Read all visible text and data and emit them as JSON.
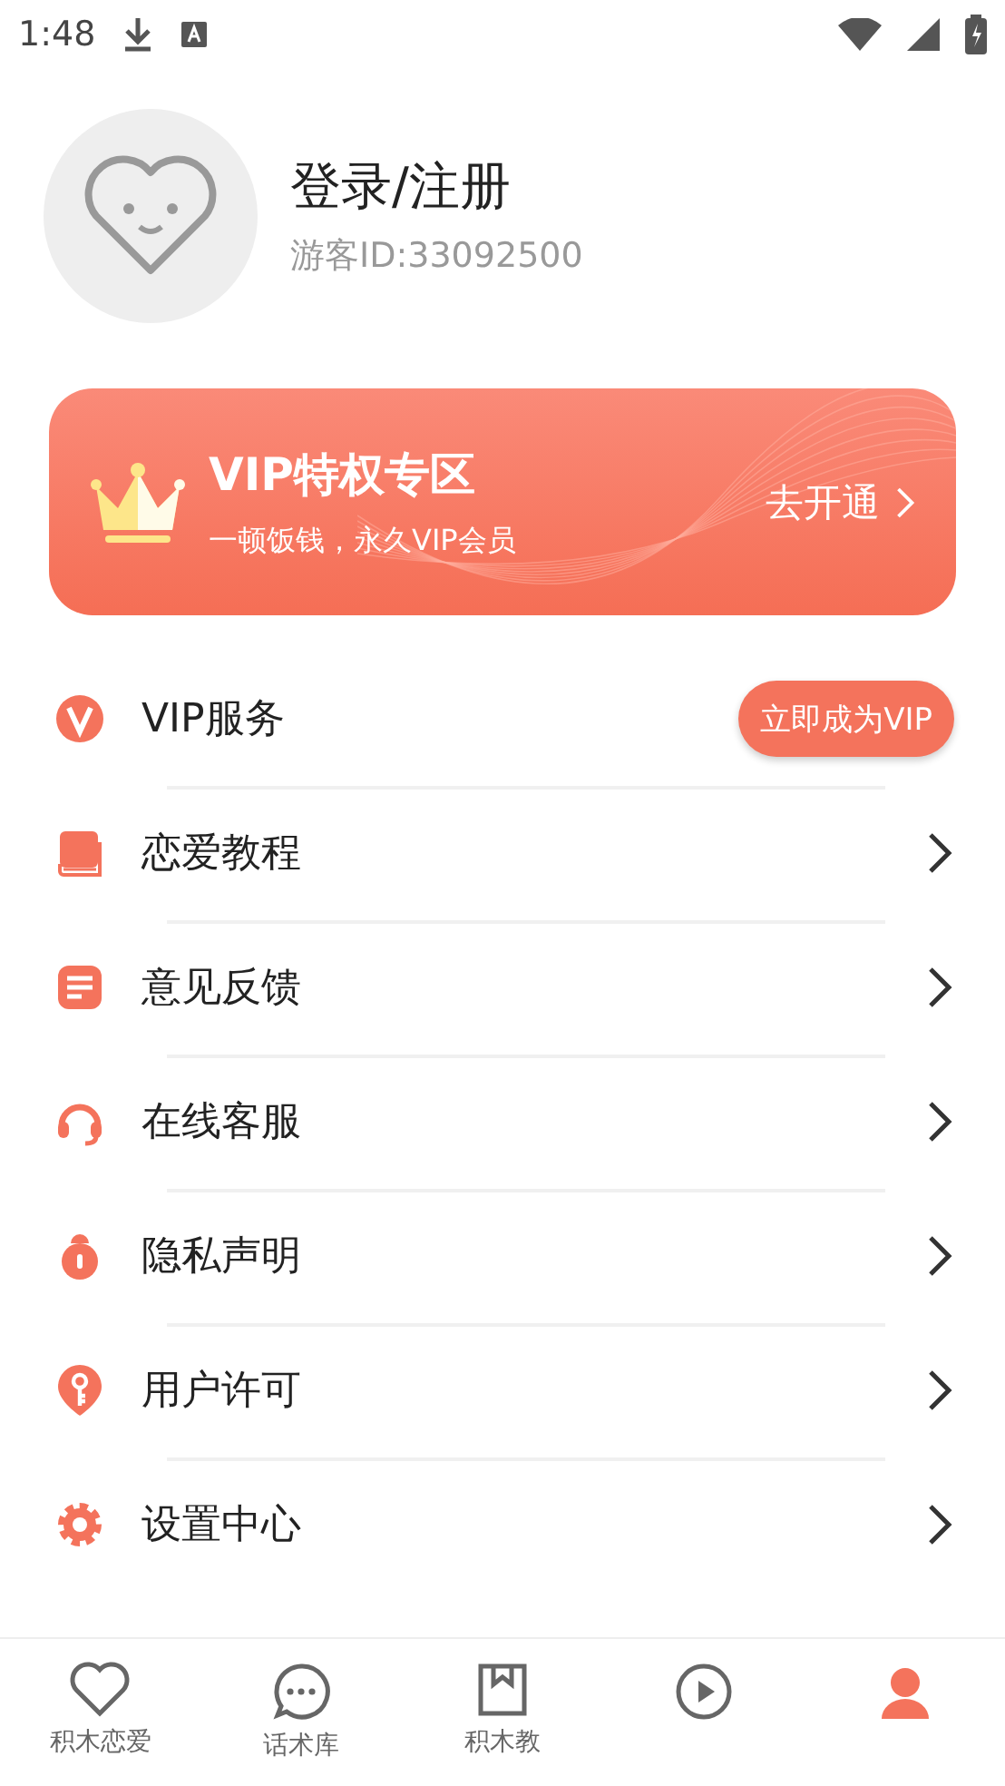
{
  "status_bar": {
    "time": "1:48"
  },
  "profile": {
    "title": "登录/注册",
    "guest_id": "游客ID:33092500"
  },
  "vip_banner": {
    "title": "VIP特权专区",
    "subtitle": "一顿饭钱，永久VIP会员",
    "action": "去开通"
  },
  "menu": [
    {
      "kind": "vip",
      "label": "VIP服务",
      "button": "立即成为VIP"
    },
    {
      "kind": "link",
      "label": "恋爱教程"
    },
    {
      "kind": "link",
      "label": "意见反馈"
    },
    {
      "kind": "link",
      "label": "在线客服"
    },
    {
      "kind": "link",
      "label": "隐私声明"
    },
    {
      "kind": "link",
      "label": "用户许可"
    },
    {
      "kind": "link",
      "label": "设置中心"
    }
  ],
  "bottom_nav": [
    {
      "label": "积木恋爱",
      "selected": false
    },
    {
      "label": "话术库",
      "selected": false
    },
    {
      "label": "积木教",
      "selected": false
    },
    {
      "selected": false
    },
    {
      "selected": true
    }
  ]
}
